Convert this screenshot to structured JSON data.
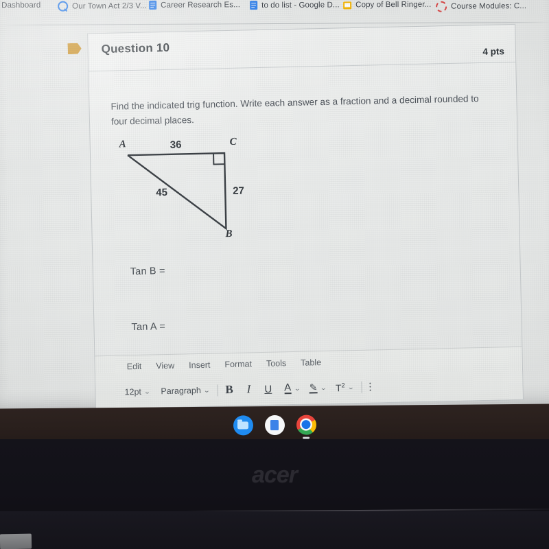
{
  "browser": {
    "tabs": [
      {
        "label": "Dashboard",
        "icon": null
      },
      {
        "label": "Our Town Act 2/3 V...",
        "icon": "quizlet-icon"
      },
      {
        "label": "Career Research Es...",
        "icon": "google-docs-icon"
      },
      {
        "label": "to do list - Google D...",
        "icon": "google-docs-icon"
      },
      {
        "label": "Copy of Bell Ringer...",
        "icon": "google-slides-icon"
      },
      {
        "label": "Course Modules: C...",
        "icon": "canvas-icon"
      }
    ]
  },
  "question": {
    "flag_color": "#c98a16",
    "title": "Question 10",
    "points": "4 pts",
    "text": "Find the indicated trig function.  Write each answer as a fraction and a decimal rounded to four decimal places.",
    "prompts": [
      "Tan B =",
      "Tan A ="
    ]
  },
  "figure": {
    "vertices": {
      "A": "A",
      "B": "B",
      "C": "C"
    },
    "sides": {
      "AC": "36",
      "AB": "45",
      "CB": "27"
    },
    "right_angle_at": "C"
  },
  "editor": {
    "menus": [
      "Edit",
      "View",
      "Insert",
      "Format",
      "Tools",
      "Table"
    ],
    "font_size": "12pt",
    "block_format": "Paragraph",
    "buttons": {
      "bold": "B",
      "italic": "I",
      "underline": "U",
      "text_color": "A",
      "highlight": "✎",
      "superscript": "T"
    },
    "superscript_exp": "2",
    "chevron": "⌄"
  },
  "shelf": {
    "items": [
      {
        "name": "files-app",
        "label": "Files"
      },
      {
        "name": "google-docs-app",
        "label": "Docs"
      },
      {
        "name": "chrome-app",
        "label": "Chrome"
      }
    ]
  },
  "device": {
    "brand": "acer"
  }
}
